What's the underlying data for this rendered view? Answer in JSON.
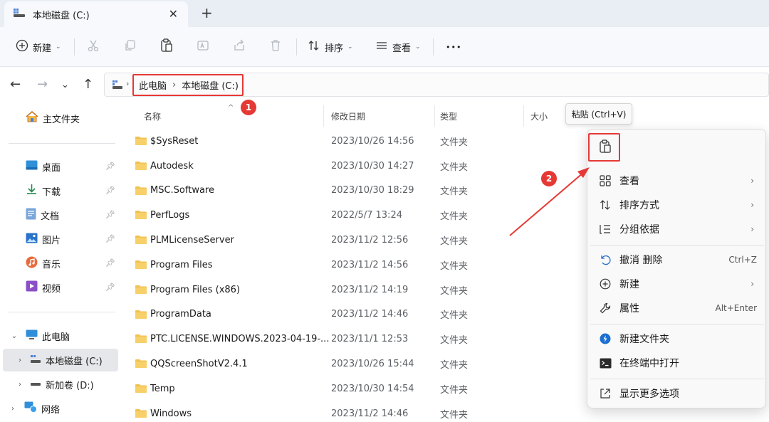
{
  "tab": {
    "title": "本地磁盘 (C:)",
    "close": "✕",
    "new_tab": "+"
  },
  "toolbar": {
    "new_label": "新建",
    "sort_label": "排序",
    "view_label": "查看",
    "more": "•••"
  },
  "breadcrumb": {
    "items": [
      "此电脑",
      "本地磁盘 (C:)"
    ],
    "separator": "›"
  },
  "annotations": {
    "badge1": "1",
    "badge2": "2",
    "color": "#e53935"
  },
  "sidebar": {
    "home": "主文件夹",
    "quick": [
      {
        "label": "桌面",
        "icon": "desktop-icon"
      },
      {
        "label": "下载",
        "icon": "download-icon"
      },
      {
        "label": "文档",
        "icon": "document-icon"
      },
      {
        "label": "图片",
        "icon": "picture-icon"
      },
      {
        "label": "音乐",
        "icon": "music-icon"
      },
      {
        "label": "视频",
        "icon": "video-icon"
      }
    ],
    "this_pc": "此电脑",
    "drive_c": "本地磁盘 (C:)",
    "drive_d": "新加卷 (D:)",
    "network": "网络"
  },
  "columns": {
    "name": "名称",
    "modified": "修改日期",
    "type": "类型",
    "size": "大小"
  },
  "files": [
    {
      "name": "$SysReset",
      "date": "2023/10/26 14:56",
      "type": "文件夹"
    },
    {
      "name": "Autodesk",
      "date": "2023/10/30 14:27",
      "type": "文件夹"
    },
    {
      "name": "MSC.Software",
      "date": "2023/10/30 18:29",
      "type": "文件夹"
    },
    {
      "name": "PerfLogs",
      "date": "2022/5/7 13:24",
      "type": "文件夹"
    },
    {
      "name": "PLMLicenseServer",
      "date": "2023/11/2 12:56",
      "type": "文件夹"
    },
    {
      "name": "Program Files",
      "date": "2023/11/2 14:56",
      "type": "文件夹"
    },
    {
      "name": "Program Files (x86)",
      "date": "2023/11/2 14:19",
      "type": "文件夹"
    },
    {
      "name": "ProgramData",
      "date": "2023/11/2 14:46",
      "type": "文件夹"
    },
    {
      "name": "PTC.LICENSE.WINDOWS.2023-04-19-...",
      "date": "2023/11/1 12:53",
      "type": "文件夹"
    },
    {
      "name": "QQScreenShotV2.4.1",
      "date": "2023/10/26 15:44",
      "type": "文件夹"
    },
    {
      "name": "Temp",
      "date": "2023/10/30 14:54",
      "type": "文件夹"
    },
    {
      "name": "Windows",
      "date": "2023/11/2 14:46",
      "type": "文件夹"
    }
  ],
  "tooltip": {
    "text": "粘贴 (Ctrl+V)"
  },
  "context_menu": {
    "items": [
      {
        "label": "查看",
        "shortcut": "",
        "submenu": true
      },
      {
        "label": "排序方式",
        "shortcut": "",
        "submenu": true
      },
      {
        "label": "分组依据",
        "shortcut": "",
        "submenu": true
      },
      {
        "label": "撤消 删除",
        "shortcut": "Ctrl+Z",
        "submenu": false
      },
      {
        "label": "新建",
        "shortcut": "",
        "submenu": true
      },
      {
        "label": "属性",
        "shortcut": "Alt+Enter",
        "submenu": false
      },
      {
        "label": "新建文件夹",
        "shortcut": "",
        "submenu": false
      },
      {
        "label": "在终端中打开",
        "shortcut": "",
        "submenu": false
      },
      {
        "label": "显示更多选项",
        "shortcut": "",
        "submenu": false
      }
    ]
  }
}
